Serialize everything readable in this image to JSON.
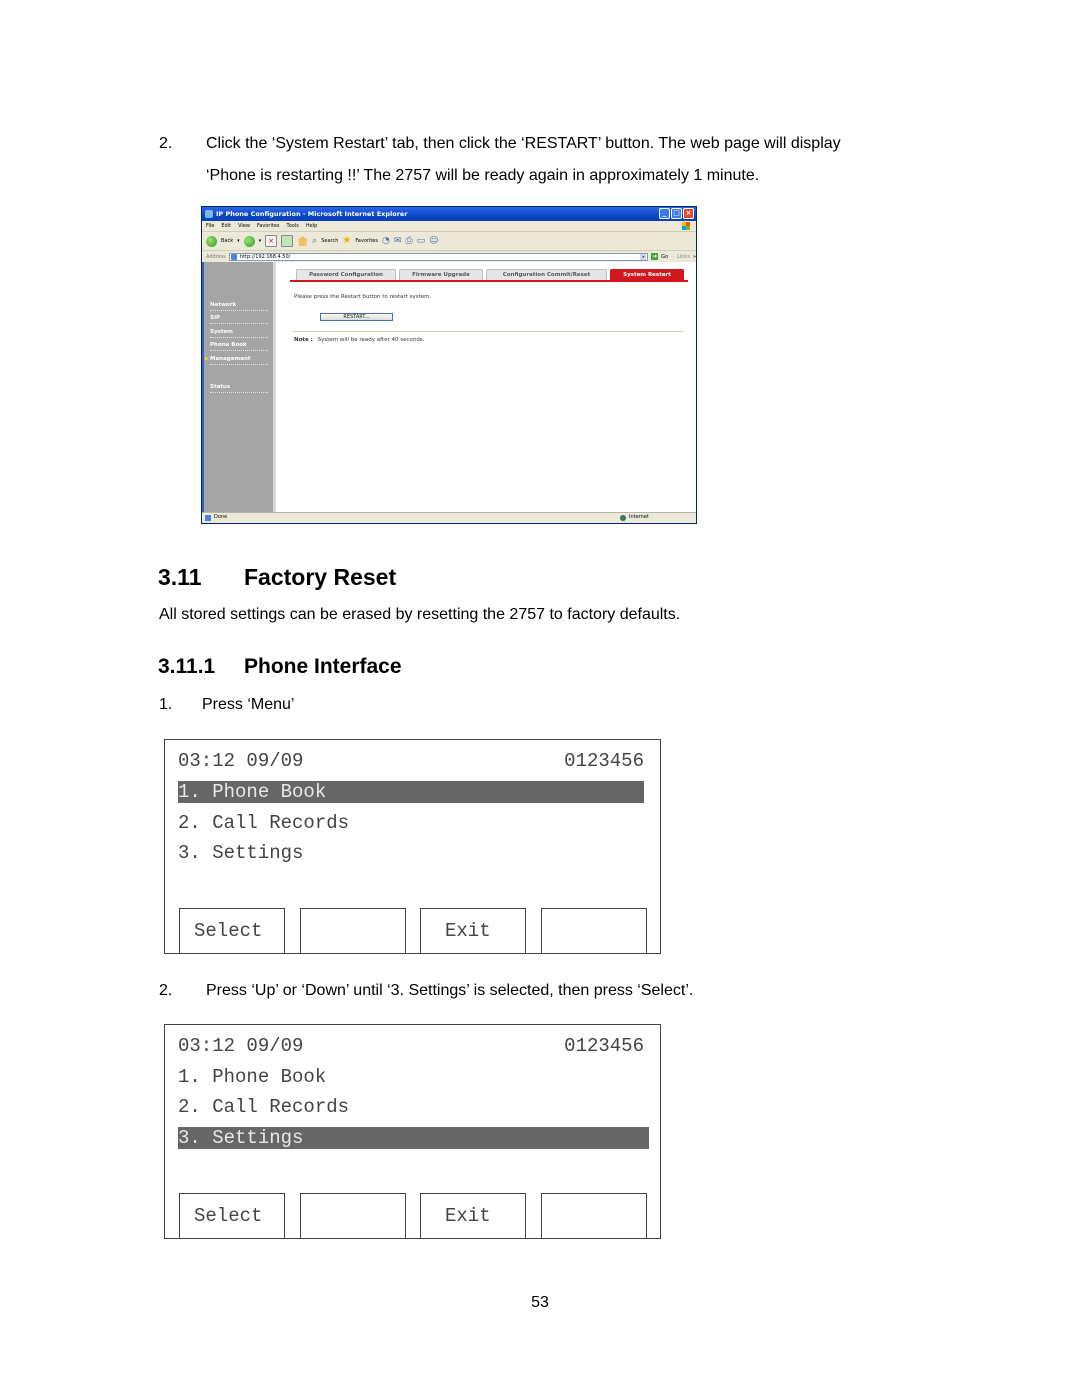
{
  "step2_restart": {
    "number": "2.",
    "line1": "Click the ‘System Restart’ tab, then click the ‘RESTART’ button.   The web page will display",
    "line2": "‘Phone is restarting !!’   The 2757 will be ready again in approximately 1 minute."
  },
  "browser": {
    "title": "IP Phone Configuration - Microsoft Internet Explorer",
    "window_buttons": [
      "_",
      "□",
      "×"
    ],
    "menu": [
      "File",
      "Edit",
      "View",
      "Favorites",
      "Tools",
      "Help"
    ],
    "toolbar": {
      "back": "Back",
      "search": "Search",
      "favorites": "Favorites"
    },
    "address_label": "Address",
    "address_value": "http://192.168.4.50/",
    "go_label": "Go",
    "links_label": "Links",
    "sidebar": [
      "Network",
      "SIP",
      "System",
      "Phone Book",
      "Management",
      "Status"
    ],
    "sidebar_active": "Management",
    "tabs": [
      {
        "label": "Password Configuration",
        "active": false
      },
      {
        "label": "Firmware Upgrade",
        "active": false
      },
      {
        "label": "Configuration Commit/Reset",
        "active": false
      },
      {
        "label": "System Restart",
        "active": true
      }
    ],
    "prompt": "Please press the Restart button to restart system.",
    "restart_button": "RESTART...",
    "note_label": "Note :",
    "note_text": "System will be ready after 40 seconds.",
    "status_text": "Done",
    "zone_text": "Internet",
    "accent_color": "#d0181e"
  },
  "section": {
    "number": "3.11",
    "title": "Factory Reset",
    "intro": "All stored settings can be erased by resetting the 2757 to factory defaults."
  },
  "subsection": {
    "number": "3.11.1",
    "title": "Phone Interface"
  },
  "steps": [
    {
      "number": "1.",
      "text": "Press ‘Menu’"
    },
    {
      "number": "2.",
      "text": "Press ‘Up’ or ‘Down’ until ‘3. Settings’ is selected, then press ‘Select’."
    }
  ],
  "lcd_screens": [
    {
      "time_date": "03:12 09/09",
      "number": "0123456",
      "menu": [
        "1. Phone Book",
        "2. Call Records",
        "3. Settings"
      ],
      "selected_index": 0,
      "softkeys": [
        "Select",
        "",
        "Exit",
        ""
      ]
    },
    {
      "time_date": "03:12 09/09",
      "number": "0123456",
      "menu": [
        "1. Phone Book",
        "2. Call Records",
        "3. Settings"
      ],
      "selected_index": 2,
      "softkeys": [
        "Select",
        "",
        "Exit",
        ""
      ]
    }
  ],
  "page_number": "53"
}
